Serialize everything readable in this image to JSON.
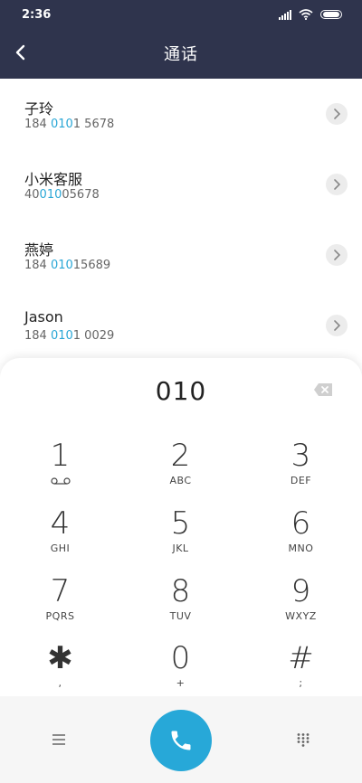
{
  "status_bar": {
    "time": "2:36"
  },
  "header": {
    "title": "通话"
  },
  "results": [
    {
      "name": "子玲",
      "number_pre": "184 ",
      "number_match": "010",
      "number_post": "1 5678"
    },
    {
      "name": "小米客服",
      "number_pre": "40",
      "number_match": "010",
      "number_post": "05678"
    },
    {
      "name": "燕婷",
      "number_pre": "184 ",
      "number_match": "010",
      "number_post": "15689"
    },
    {
      "name": "Jason",
      "number_pre": "184 ",
      "number_match": "010",
      "number_post": "1 0029"
    }
  ],
  "dialer": {
    "input": "010",
    "keys": [
      {
        "digit": "1",
        "letters": ""
      },
      {
        "digit": "2",
        "letters": "ABC"
      },
      {
        "digit": "3",
        "letters": "DEF"
      },
      {
        "digit": "4",
        "letters": "GHI"
      },
      {
        "digit": "5",
        "letters": "JKL"
      },
      {
        "digit": "6",
        "letters": "MNO"
      },
      {
        "digit": "7",
        "letters": "PQRS"
      },
      {
        "digit": "8",
        "letters": "TUV"
      },
      {
        "digit": "9",
        "letters": "WXYZ"
      },
      {
        "digit": "✱",
        "letters": ","
      },
      {
        "digit": "0",
        "letters": "+"
      },
      {
        "digit": "#",
        "letters": ";"
      }
    ]
  },
  "colors": {
    "header_bg": "#2f344d",
    "accent": "#27a8d8",
    "highlight": "#2aa7d6"
  },
  "icons": {
    "back": "chevron-left-icon",
    "backspace": "backspace-icon",
    "voicemail": "voicemail-icon",
    "menu": "menu-icon",
    "call": "phone-icon",
    "dialpad": "dialpad-icon"
  }
}
